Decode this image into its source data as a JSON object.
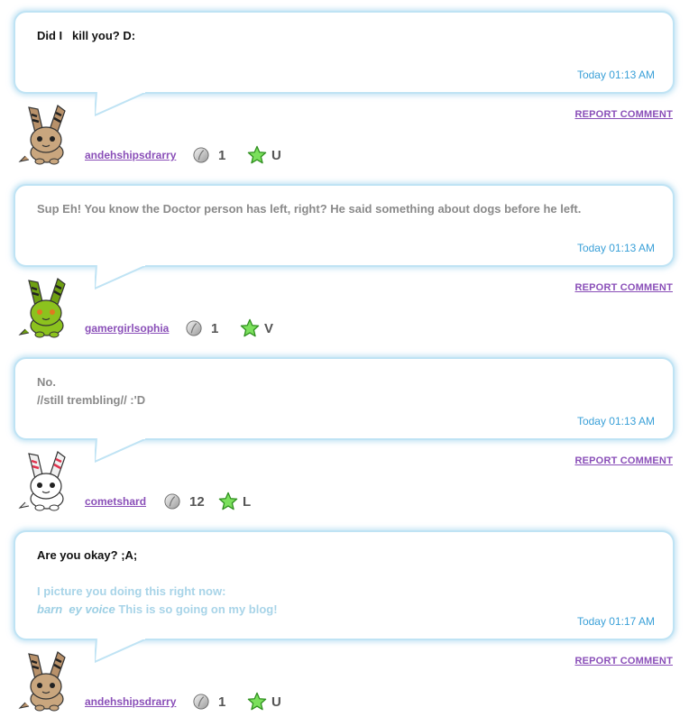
{
  "comments": [
    {
      "lines": [
        [
          {
            "text": "Did I   kill you? D:",
            "style": "black"
          }
        ]
      ],
      "timestamp": "Today 01:13 AM",
      "report_label": "REPORT COMMENT",
      "username": "andehshipsdrarry",
      "count": "1",
      "rank": "U",
      "avatar": "tan-bunny-pet"
    },
    {
      "lines": [
        [
          {
            "text": "Sup Eh! You know the Doctor person has left, right? He said something about dogs before he left.",
            "style": "gray"
          }
        ]
      ],
      "timestamp": "Today 01:13 AM",
      "report_label": "REPORT COMMENT",
      "username": "gamergirlsophia",
      "count": "1",
      "rank": "V",
      "avatar": "green-bunny-pet"
    },
    {
      "lines": [
        [
          {
            "text": "No.",
            "style": "gray"
          }
        ],
        [
          {
            "text": "//still trembling// :'D",
            "style": "gray"
          }
        ]
      ],
      "timestamp": "Today 01:13 AM",
      "report_label": "REPORT COMMENT",
      "username": "cometshard",
      "count": "12",
      "rank": "L",
      "avatar": "white-bunny-pet"
    },
    {
      "lines": [
        [
          {
            "text": "Are you okay? ;A;",
            "style": "black"
          }
        ],
        [
          {
            "text": "",
            "style": "black"
          }
        ],
        [
          {
            "text": "I picture you doing this right now:",
            "style": "light"
          }
        ],
        [
          {
            "text": "barn  ey voice",
            "style": "ital"
          },
          {
            "text": " This is so going on my blog!",
            "style": "light"
          }
        ]
      ],
      "timestamp": "Today 01:17 AM",
      "report_label": "REPORT COMMENT",
      "username": "andehshipsdrarry",
      "count": "1",
      "rank": "U",
      "avatar": "tan-bunny-pet"
    }
  ],
  "colors": {
    "bubble_border": "#bfe3f4",
    "timestamp": "#3aa0d8",
    "link": "#8a4fb8",
    "star": "#5fd04a"
  }
}
